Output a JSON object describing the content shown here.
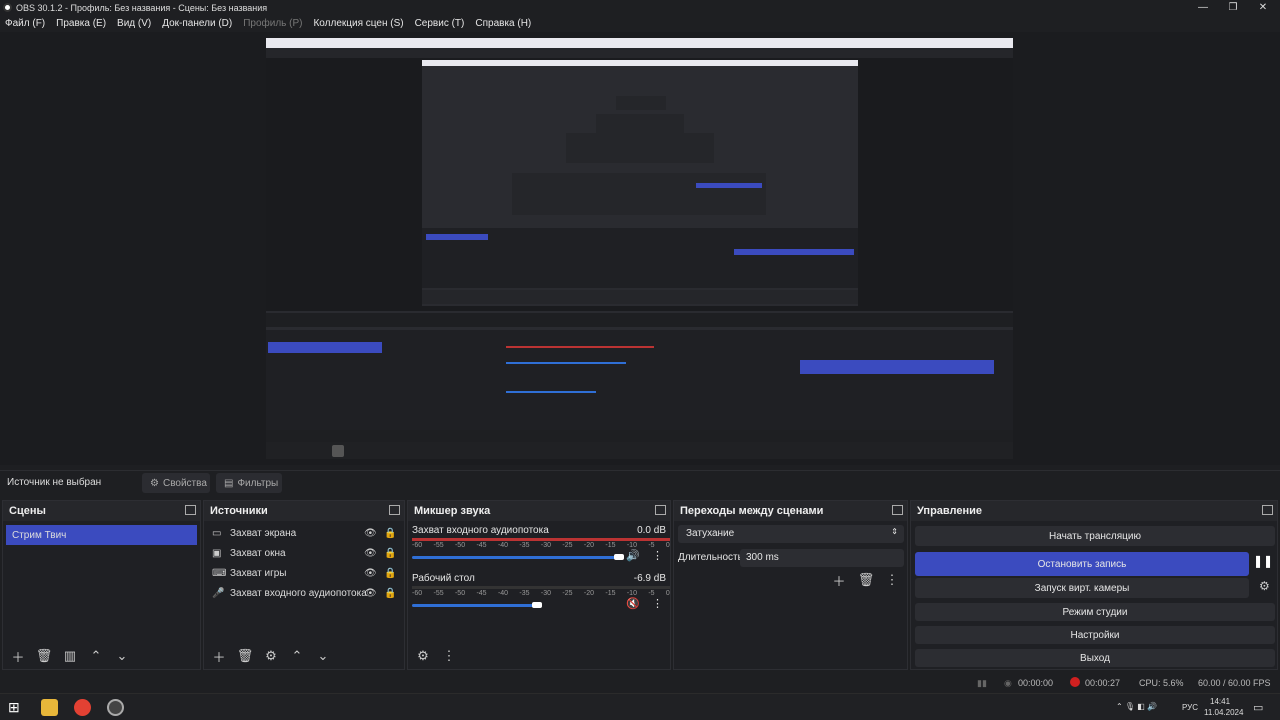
{
  "window": {
    "title": "OBS 30.1.2 - Профиль: Без названия - Сцены: Без названия"
  },
  "menu": [
    {
      "label": "Файл (F)",
      "disabled": false
    },
    {
      "label": "Правка (E)",
      "disabled": false
    },
    {
      "label": "Вид (V)",
      "disabled": false
    },
    {
      "label": "Док-панели (D)",
      "disabled": false
    },
    {
      "label": "Профиль (P)",
      "disabled": true
    },
    {
      "label": "Коллекция сцен (S)",
      "disabled": false
    },
    {
      "label": "Сервис (T)",
      "disabled": false
    },
    {
      "label": "Справка (H)",
      "disabled": false
    }
  ],
  "source_bar": {
    "label": "Источник не выбран",
    "properties": "Свойства",
    "filters": "Фильтры"
  },
  "scenes": {
    "title": "Сцены",
    "items": [
      "Стрим Твич"
    ]
  },
  "sources": {
    "title": "Источники",
    "items": [
      {
        "label": "Захват экрана",
        "icon": "monitor-icon"
      },
      {
        "label": "Захват окна",
        "icon": "window-icon"
      },
      {
        "label": "Захват игры",
        "icon": "gamepad-icon"
      },
      {
        "label": "Захват входного аудиопотока",
        "icon": "microphone-icon"
      }
    ]
  },
  "mixer": {
    "title": "Микшер звука",
    "ticks": [
      "-60",
      "-55",
      "-50",
      "-45",
      "-40",
      "-35",
      "-30",
      "-25",
      "-20",
      "-15",
      "-10",
      "-5",
      "0"
    ],
    "channels": [
      {
        "name": "Захват входного аудиопотока",
        "db": "0.0 dB",
        "volume": 1.0,
        "muted": false
      },
      {
        "name": "Рабочий стол",
        "db": "-6.9 dB",
        "volume": 0.6,
        "muted": true
      }
    ]
  },
  "transitions": {
    "title": "Переходы между сценами",
    "type": "Затухание",
    "duration_label": "Длительность",
    "duration_value": "300 ms"
  },
  "controls": {
    "title": "Управление",
    "buttons": [
      {
        "label": "Начать трансляцию",
        "active": false
      },
      {
        "label": "Остановить запись",
        "active": true
      },
      {
        "label": "Запуск вирт. камеры",
        "active": false
      },
      {
        "label": "Режим студии",
        "active": false
      },
      {
        "label": "Настройки",
        "active": false
      },
      {
        "label": "Выход",
        "active": false
      }
    ]
  },
  "status": {
    "stream_time": "00:00:00",
    "rec_time": "00:00:27",
    "cpu": "CPU: 5.6%",
    "fps": "60.00 / 60.00 FPS"
  },
  "taskbar": {
    "lang": "РУС",
    "time": "14:41",
    "date": "11.04.2024"
  },
  "colors": {
    "accent": "#3b4bbf",
    "recording": "#d02020"
  }
}
